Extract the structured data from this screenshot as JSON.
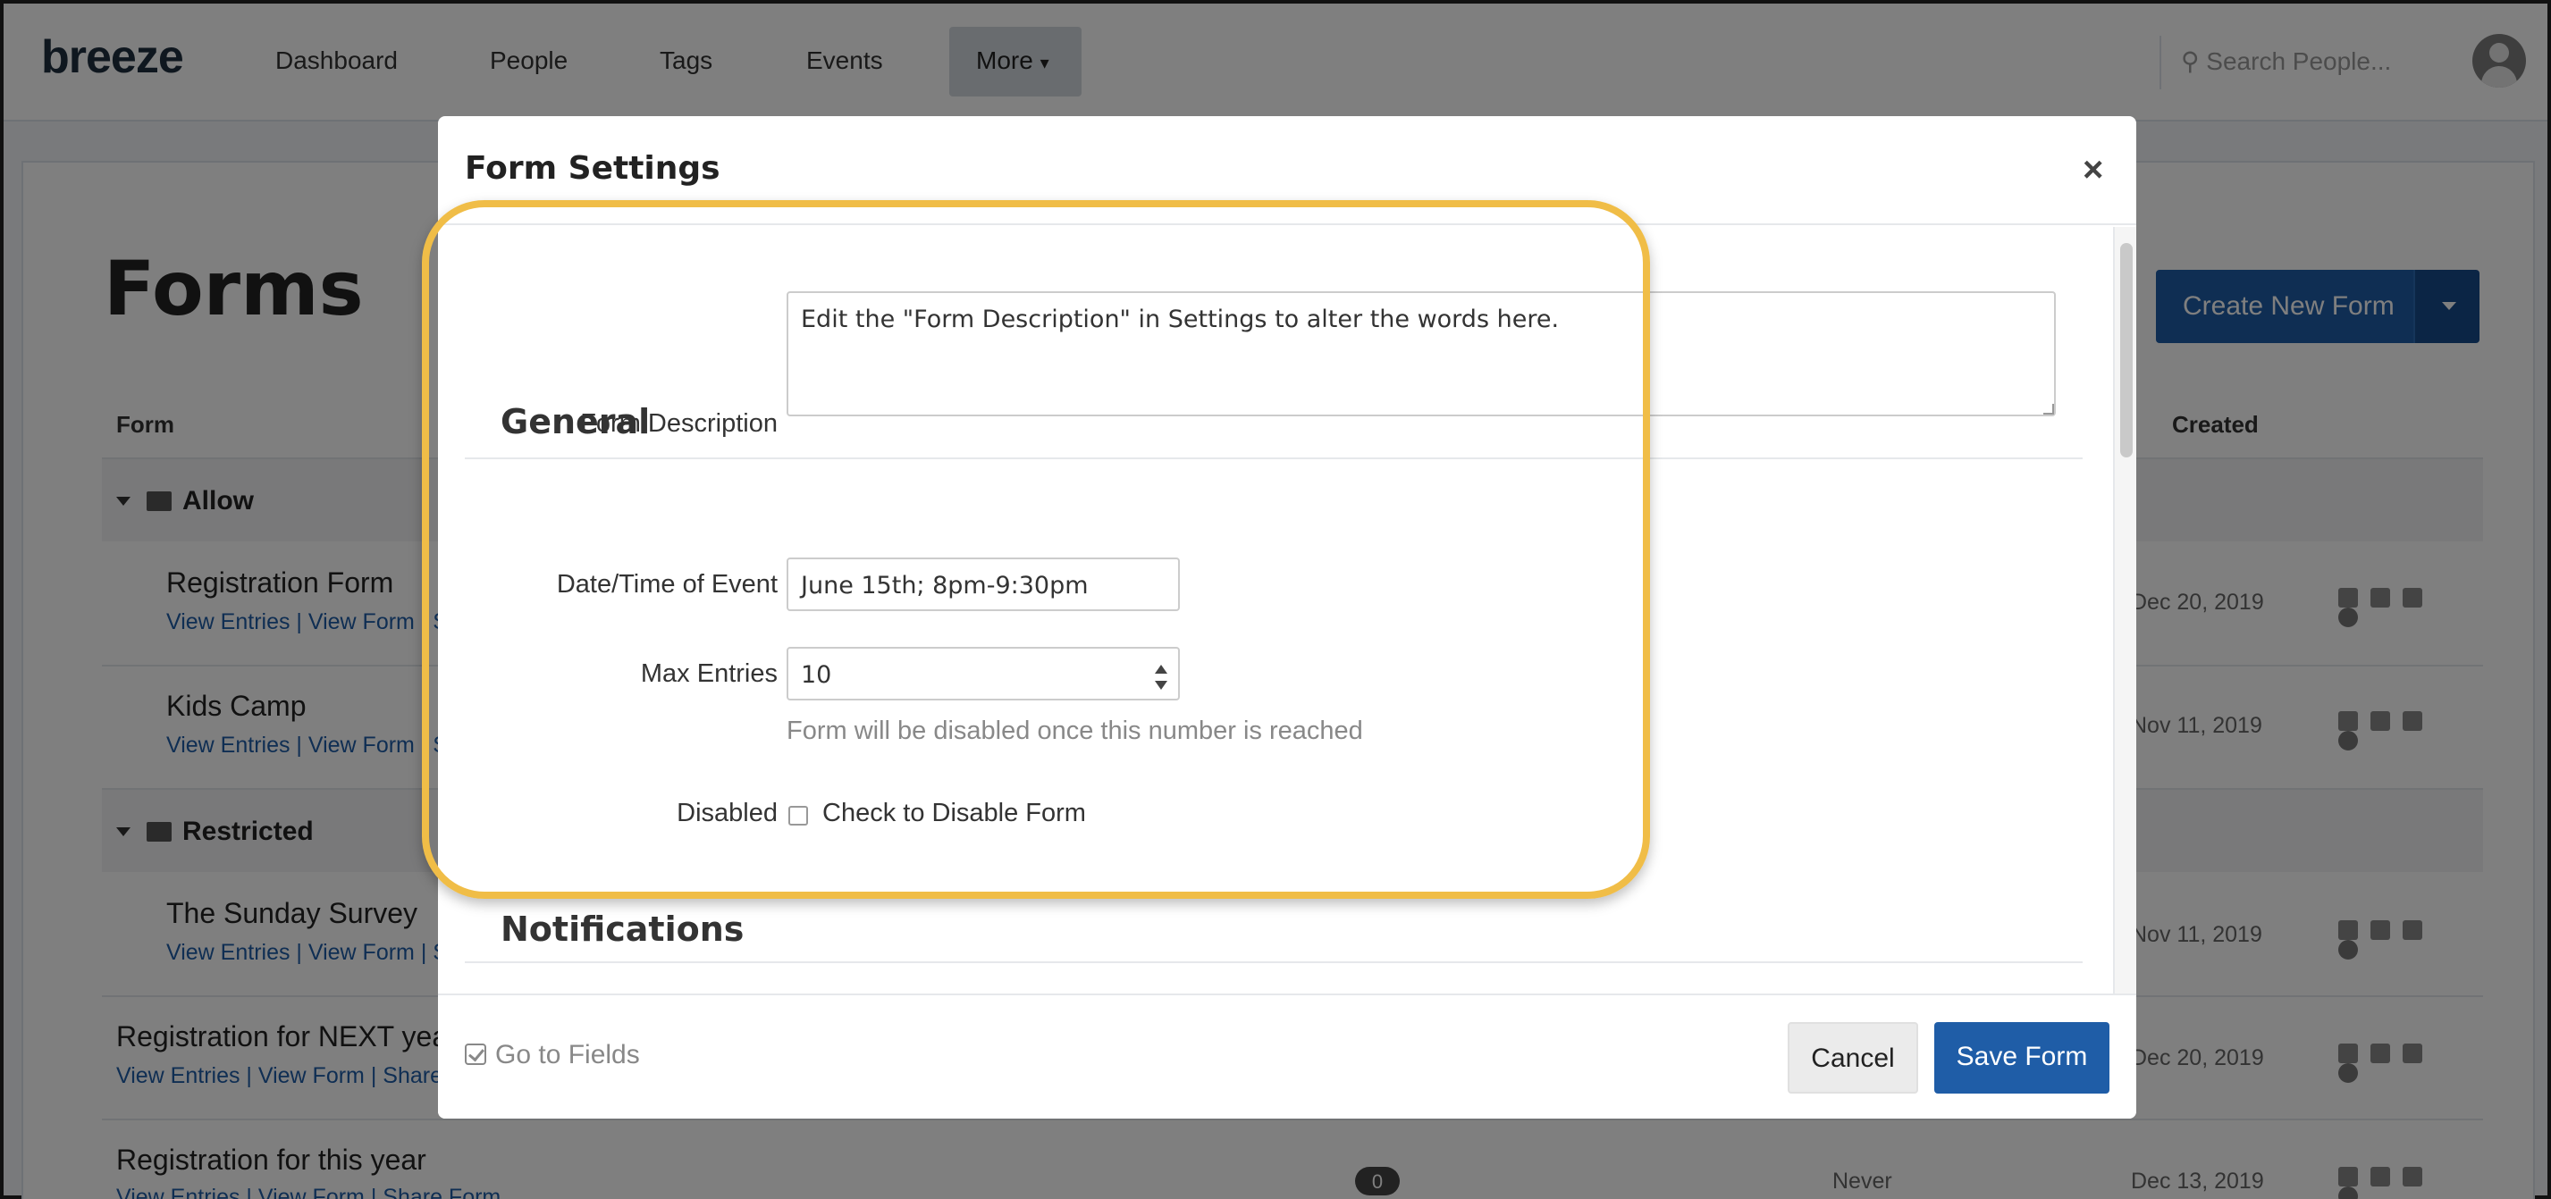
{
  "app": {
    "logo": "breeze",
    "nav": [
      "Dashboard",
      "People",
      "Tags",
      "Events"
    ],
    "nav_more": "More",
    "search_placeholder": "Search People..."
  },
  "page": {
    "title": "Forms",
    "create_button": "Create New Form",
    "columns": {
      "form": "Form",
      "created": "Created"
    },
    "folders": [
      {
        "name": "Allow"
      },
      {
        "name": "Restricted"
      }
    ],
    "rows": [
      {
        "name": "Registration Form",
        "links": "View Entries | View Form | S",
        "created": "Dec 20, 2019"
      },
      {
        "name": "Kids Camp",
        "links": "View Entries | View Form | S",
        "created": "Nov 11, 2019"
      },
      {
        "name": "The Sunday Survey",
        "links": "View Entries | View Form | S",
        "created": "Nov 11, 2019"
      },
      {
        "name": "Registration for NEXT yea",
        "links": "View Entries | View Form | Share",
        "created": "Dec 20, 2019"
      },
      {
        "name": "Registration for this year",
        "links": "View Entries | View Form | Share Form",
        "entries": "0",
        "last": "Never",
        "created": "Dec 13, 2019"
      }
    ]
  },
  "modal": {
    "title": "Form Settings",
    "close": "×",
    "general": {
      "title": "General",
      "description_label": "Form Description",
      "description_value": "Edit the \"Form Description\" in Settings to alter the words here.",
      "date_label": "Date/Time of Event",
      "date_value": "June 15th; 8pm-9:30pm",
      "max_label": "Max Entries",
      "max_value": "10",
      "max_help": "Form will be disabled once this number is reached",
      "disabled_label": "Disabled",
      "disabled_checkbox": "Check to Disable Form"
    },
    "notifications": {
      "title": "Notifications"
    },
    "footer": {
      "goto_fields": "Go to Fields",
      "cancel": "Cancel",
      "save": "Save Form"
    }
  },
  "colors": {
    "primary": "#1f5da7",
    "highlight": "#f0bd47"
  }
}
